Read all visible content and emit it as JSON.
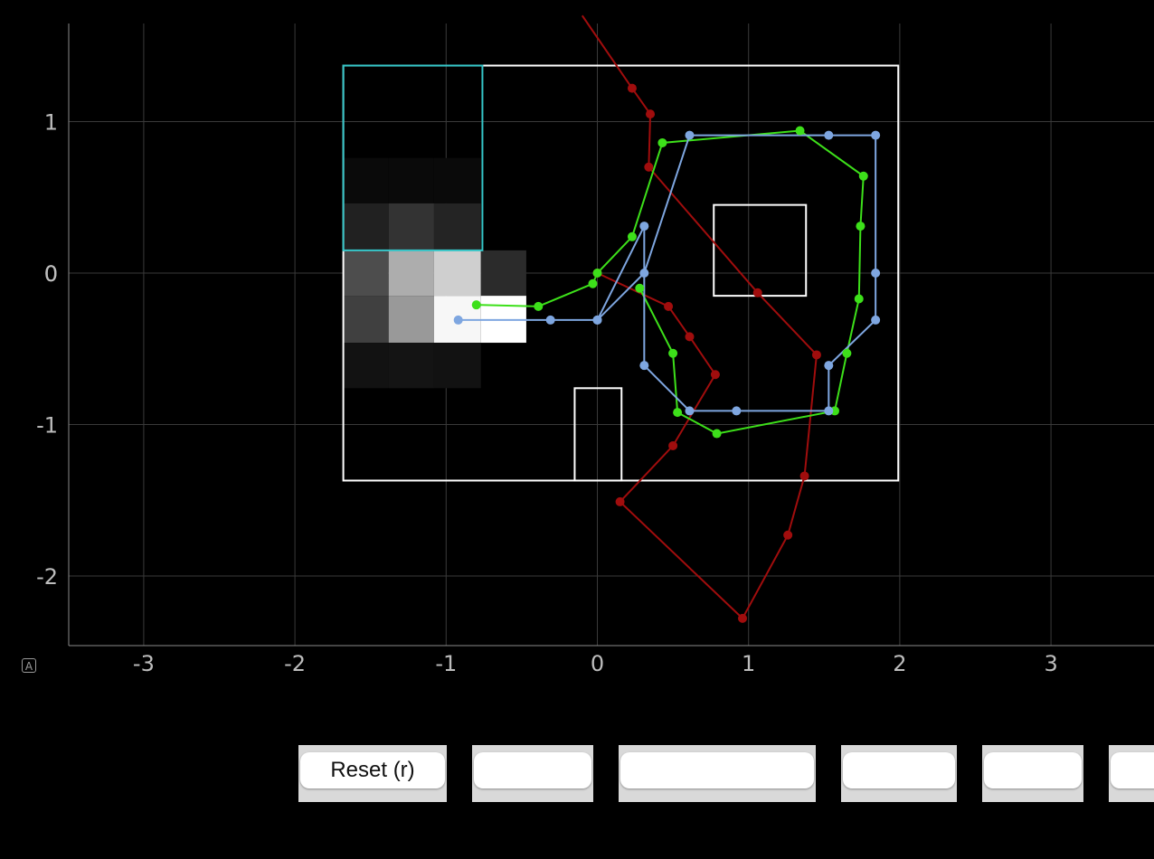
{
  "chart_data": {
    "type": "line",
    "title": "",
    "xlabel": "",
    "ylabel": "",
    "xlim": [
      -3.5,
      3.7
    ],
    "ylim": [
      -2.45,
      1.65
    ],
    "x_ticks": [
      -3,
      -2,
      -1,
      0,
      1,
      2,
      3
    ],
    "y_ticks": [
      1,
      0,
      -1,
      -2
    ],
    "grid": true,
    "colors": {
      "background": "#000000",
      "grid": "#3a3a3a",
      "axis": "#8a8a8a",
      "boxes": "#ffffff",
      "cyan_box": "#35c6c8"
    },
    "boxes": [
      {
        "name": "arena",
        "x": [
          -1.68,
          1.99
        ],
        "y": [
          -1.37,
          1.37
        ],
        "color": "#ffffff"
      },
      {
        "name": "inner-square",
        "x": [
          0.77,
          1.38
        ],
        "y": [
          -0.15,
          0.45
        ],
        "color": "#ffffff"
      },
      {
        "name": "gate",
        "x": [
          -0.15,
          0.16
        ],
        "y": [
          -1.37,
          -0.76
        ],
        "color": "#ffffff"
      },
      {
        "name": "start-region",
        "x": [
          -1.68,
          -0.76
        ],
        "y": [
          0.15,
          1.37
        ],
        "color": "#35c6c8"
      }
    ],
    "heatmap": {
      "x_edges": [
        -1.68,
        -1.38,
        -1.08,
        -0.77,
        -0.47
      ],
      "y_edges": [
        0.76,
        0.46,
        0.15,
        -0.15,
        -0.46,
        -0.76
      ],
      "values": [
        [
          0.04,
          0.04,
          0.04,
          null
        ],
        [
          0.13,
          0.2,
          0.14,
          null
        ],
        [
          0.3,
          0.68,
          0.81,
          0.17
        ],
        [
          0.25,
          0.6,
          0.97,
          1.0
        ],
        [
          0.07,
          0.08,
          0.07,
          null
        ]
      ]
    },
    "series": [
      {
        "color": "#a00d0d",
        "x": [
          -0.1,
          0.23,
          0.35,
          0.34,
          1.06,
          1.45,
          1.37,
          1.26,
          0.96,
          0.15,
          0.5,
          0.78,
          0.61,
          0.47,
          0.0
        ],
        "y": [
          1.7,
          1.22,
          1.05,
          0.7,
          -0.13,
          -0.54,
          -1.34,
          -1.73,
          -2.28,
          -1.51,
          -1.14,
          -0.67,
          -0.42,
          -0.22,
          0.0
        ]
      },
      {
        "color": "#3de01a",
        "x": [
          -0.8,
          -0.39,
          -0.03,
          0.0,
          0.23,
          0.43,
          1.34,
          1.76,
          1.74,
          1.73,
          1.65,
          1.57,
          0.79,
          0.53,
          0.5,
          0.28
        ],
        "y": [
          -0.21,
          -0.22,
          -0.07,
          0.0,
          0.24,
          0.86,
          0.94,
          0.64,
          0.31,
          -0.17,
          -0.53,
          -0.91,
          -1.06,
          -0.92,
          -0.53,
          -0.1
        ]
      },
      {
        "color": "#7ea6e0",
        "x": [
          -0.92,
          -0.31,
          0.0,
          0.31,
          0.61,
          1.53,
          1.84,
          1.84,
          1.84,
          1.53,
          1.53,
          0.92,
          0.61,
          0.31,
          0.31,
          0.0
        ],
        "y": [
          -0.31,
          -0.31,
          -0.31,
          0.0,
          0.91,
          0.91,
          0.91,
          0.0,
          -0.31,
          -0.61,
          -0.91,
          -0.91,
          -0.91,
          -0.61,
          0.31,
          -0.31
        ]
      }
    ]
  },
  "controls": {
    "buttons": [
      {
        "label": "Reset (r)"
      },
      {
        "label": ""
      },
      {
        "label": ""
      },
      {
        "label": ""
      },
      {
        "label": ""
      },
      {
        "label": ""
      }
    ]
  },
  "icons": {
    "corner": "annotation-a-icon"
  },
  "corner_glyph": "A"
}
